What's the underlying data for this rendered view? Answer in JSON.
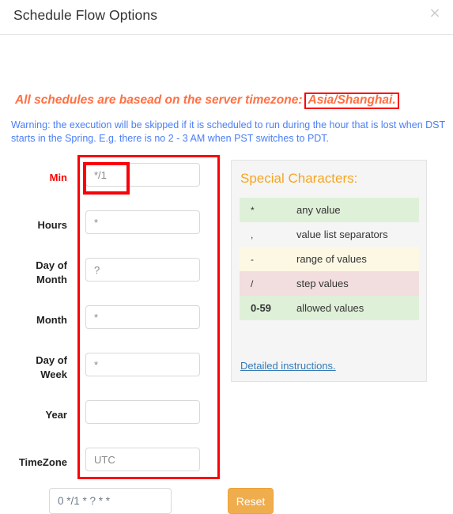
{
  "header": {
    "title": "Schedule Flow Options",
    "close_label": "×"
  },
  "notice": {
    "prefix": "All schedules are basead on the server timezone:",
    "timezone": "Asia/Shanghai.",
    "warning": "Warning: the execution will be skipped if it is scheduled to run during the hour that is lost when DST starts in the Spring. E.g. there is no 2 - 3 AM when PST switches to PDT.",
    "accent_color": "#ff7043",
    "warning_color": "#4a7ef5",
    "highlight_border_color": "#fb0007"
  },
  "form": {
    "fields": [
      {
        "label": "Min",
        "value": "*/1",
        "placeholder": "*/1",
        "highlighted": true
      },
      {
        "label": "Hours",
        "value": "*",
        "placeholder": "*",
        "highlighted": false
      },
      {
        "label": "Day of Month",
        "label_line1": "Day of",
        "label_line2": "Month",
        "value": "?",
        "placeholder": "?",
        "highlighted": false
      },
      {
        "label": "Month",
        "value": "*",
        "placeholder": "*",
        "highlighted": false
      },
      {
        "label": "Day of Week",
        "label_line1": "Day of",
        "label_line2": "Week",
        "value": "*",
        "placeholder": "*",
        "highlighted": false
      },
      {
        "label": "Year",
        "value": "",
        "placeholder": "",
        "highlighted": false
      },
      {
        "label": "TimeZone",
        "value": "UTC",
        "placeholder": "UTC",
        "highlighted": false
      }
    ]
  },
  "special_characters": {
    "title": "Special Characters:",
    "rows": [
      {
        "symbol": "*",
        "description": "any value",
        "row_color": "#dff0d8"
      },
      {
        "symbol": ",",
        "description": "value list separators",
        "row_color": "#ffffff"
      },
      {
        "symbol": "-",
        "description": "range of values",
        "row_color": "#fcf8e3"
      },
      {
        "symbol": "/",
        "description": "step values",
        "row_color": "#f2dede"
      },
      {
        "symbol": "0-59",
        "description": "allowed values",
        "row_color": "#dff0d8"
      }
    ],
    "link_label": "Detailed instructions.",
    "link_color": "#337ab7",
    "title_color": "#f5a623"
  },
  "footer": {
    "expression": "0 */1 * ? * *",
    "expression_placeholder": "0 */1 * ? * *",
    "reset_label": "Reset",
    "reset_color": "#f0ad4e"
  }
}
